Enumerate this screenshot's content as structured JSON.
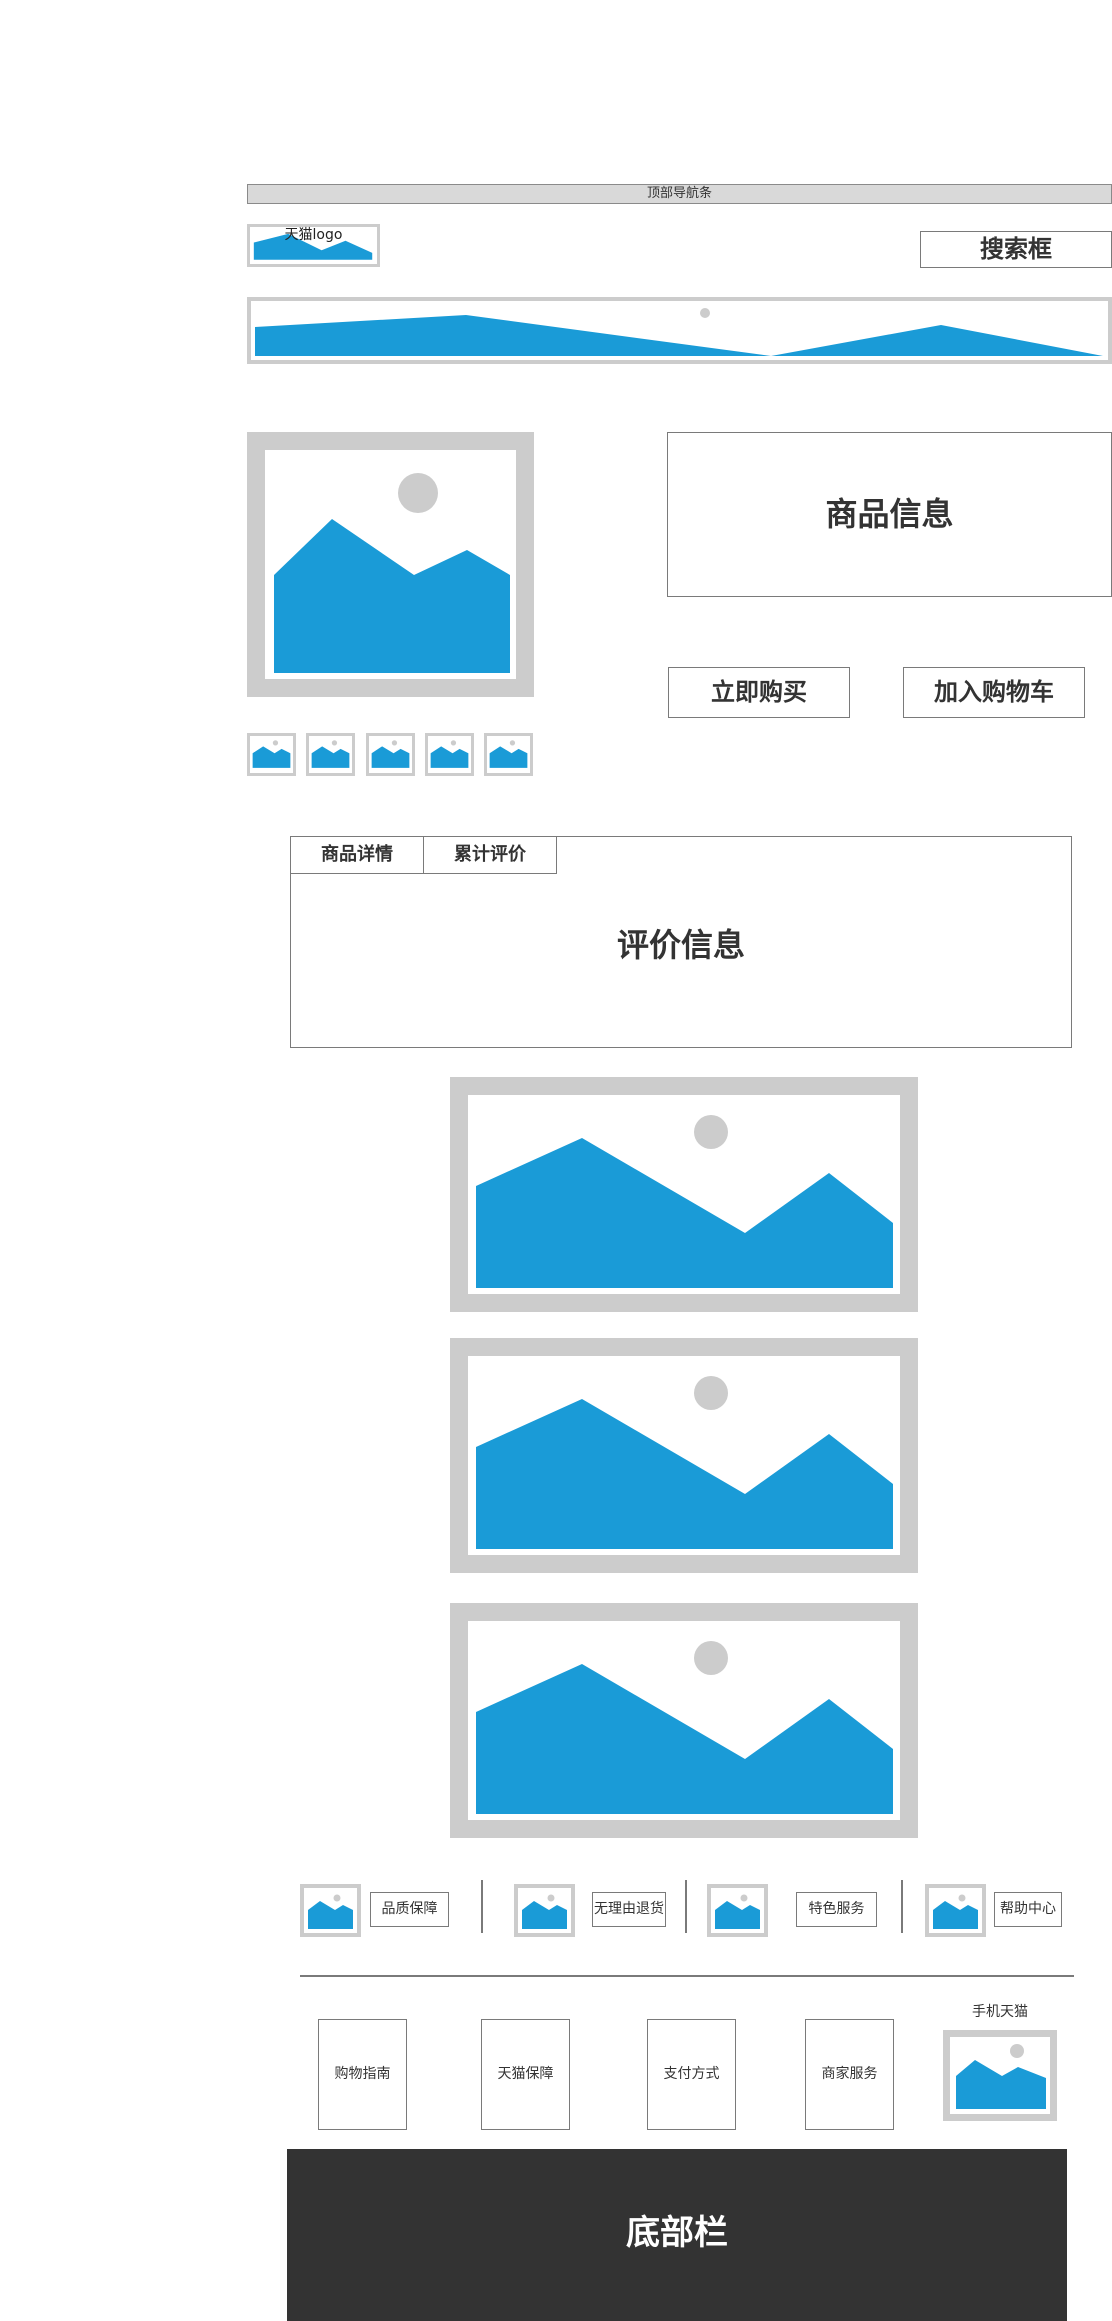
{
  "header": {
    "top_nav_label": "顶部导航条",
    "logo_label": "天猫logo",
    "search_label": "搜索框"
  },
  "product": {
    "info_label": "商品信息",
    "buy_now_label": "立即购买",
    "add_to_cart_label": "加入购物车"
  },
  "detail_tabs": {
    "tabs": [
      {
        "label": "商品详情"
      },
      {
        "label": "累计评价"
      }
    ],
    "content_label": "评价信息"
  },
  "services": [
    {
      "label": "品质保障",
      "icon": "image-placeholder-icon"
    },
    {
      "label": "无理由退货",
      "icon": "image-placeholder-icon"
    },
    {
      "label": "特色服务",
      "icon": "image-placeholder-icon"
    },
    {
      "label": "帮助中心",
      "icon": "image-placeholder-icon"
    }
  ],
  "footer": {
    "columns": [
      {
        "label": "购物指南"
      },
      {
        "label": "天猫保障"
      },
      {
        "label": "支付方式"
      },
      {
        "label": "商家服务"
      }
    ],
    "mobile_label": "手机天猫",
    "bottom_bar_label": "底部栏"
  },
  "colors": {
    "placeholder_blue": "#1a9bd7",
    "placeholder_gray": "#cccccc",
    "bottom_bar": "#333333"
  }
}
